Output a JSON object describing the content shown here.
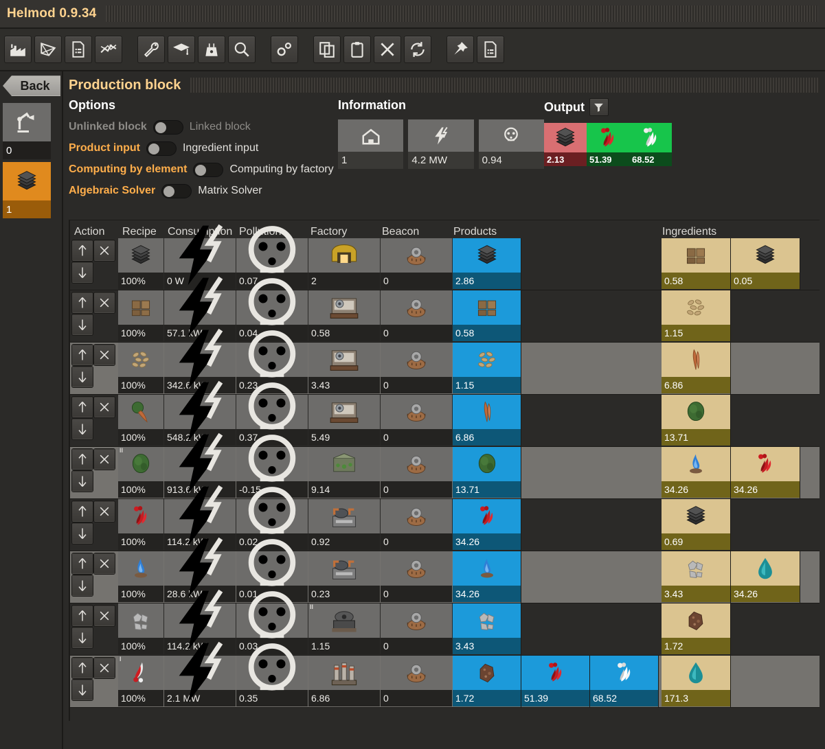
{
  "window": {
    "title": "Helmod 0.9.34"
  },
  "toolbar": {
    "buttons": [
      {
        "name": "factory-icon",
        "label": "Factory"
      },
      {
        "name": "polygon-graph-icon",
        "label": "Graph"
      },
      {
        "name": "document-icon",
        "label": "Summary"
      },
      {
        "name": "statistics-icon",
        "label": "Statistics"
      },
      {
        "name": "wrench-icon",
        "label": "Properties"
      },
      {
        "name": "graduation-cap-icon",
        "label": "Technology"
      },
      {
        "name": "power-plant-icon",
        "label": "Energy"
      },
      {
        "name": "magnifier-icon",
        "label": "Search"
      },
      {
        "name": "gears-icon",
        "label": "Preferences"
      },
      {
        "name": "copy-icon",
        "label": "Copy"
      },
      {
        "name": "clipboard-icon",
        "label": "Paste"
      },
      {
        "name": "close-x-icon",
        "label": "Erase"
      },
      {
        "name": "refresh-icon",
        "label": "Refresh"
      },
      {
        "name": "pin-icon",
        "label": "Pin"
      },
      {
        "name": "document-list-icon",
        "label": "Notes"
      }
    ]
  },
  "sidebar": {
    "back_label": "Back",
    "blocks": [
      {
        "name": "block-root",
        "icon": "robot-arm-icon",
        "label": "0",
        "selected": false
      },
      {
        "name": "block-production",
        "icon": "steel-plate-icon",
        "label": "1",
        "selected": true
      }
    ]
  },
  "panel": {
    "title": "Production block"
  },
  "options": {
    "title": "Options",
    "rows": [
      {
        "left": "Unlinked block",
        "right": "Linked block",
        "left_active": false,
        "state": "off"
      },
      {
        "left": "Product input",
        "right": "Ingredient input",
        "left_active": true,
        "state": "off"
      },
      {
        "left": "Computing by element",
        "right": "Computing by factory",
        "left_active": true,
        "state": "off"
      },
      {
        "left": "Algebraic Solver",
        "right": "Matrix Solver",
        "left_active": true,
        "state": "off"
      }
    ]
  },
  "information": {
    "title": "Information",
    "cells": [
      {
        "name": "building-count",
        "icon": "building-icon",
        "value": "1"
      },
      {
        "name": "power-usage",
        "icon": "energy-icon",
        "value": "4.2 MW"
      },
      {
        "name": "pollution",
        "icon": "pollution-icon",
        "value": "0.94"
      }
    ]
  },
  "output": {
    "title": "Output",
    "filter_icon": "filter-funnel-icon",
    "items": [
      {
        "name": "output-steel-plate",
        "icon": "steel-plate-icon",
        "value": "2.13",
        "color": "red"
      },
      {
        "name": "output-red-smoke",
        "icon": "heavy-oil-icon",
        "value": "51.39",
        "color": "green"
      },
      {
        "name": "output-white-smoke",
        "icon": "light-oil-icon",
        "value": "68.52",
        "color": "green"
      }
    ]
  },
  "table": {
    "headers": [
      "Action",
      "Recipe",
      "Consumption",
      "Pollution",
      "Factory",
      "Beacon",
      "Products",
      "Ingredients"
    ],
    "actions": {
      "up": "move-up",
      "down": "move-down",
      "remove": "remove"
    },
    "rows": [
      {
        "alt": false,
        "recipe": {
          "icon": "steel-plate-icon",
          "value": "100%"
        },
        "consumption": {
          "icon": "energy-icon",
          "value": "0 W"
        },
        "pollution": {
          "icon": "pollution-icon",
          "value": "0.07"
        },
        "factory": {
          "icon": "electric-furnace-icon",
          "value": "2"
        },
        "beacon": {
          "icon": "beacon-icon",
          "value": "0"
        },
        "products": [
          {
            "icon": "steel-plate-icon",
            "value": "2.86"
          }
        ],
        "ingredients": [
          {
            "icon": "wood-box-icon",
            "value": "0.58"
          },
          {
            "icon": "steel-plate-icon",
            "value": "0.05"
          }
        ]
      },
      {
        "alt": false,
        "recipe": {
          "icon": "wood-box-icon",
          "value": "100%"
        },
        "consumption": {
          "icon": "energy-icon",
          "value": "57.1 kW"
        },
        "pollution": {
          "icon": "pollution-icon",
          "value": "0.04"
        },
        "factory": {
          "icon": "assembling-machine-icon",
          "value": "0.58"
        },
        "beacon": {
          "icon": "beacon-icon",
          "value": "0"
        },
        "products": [
          {
            "icon": "wood-box-icon",
            "value": "0.58"
          }
        ],
        "ingredients": [
          {
            "icon": "wood-pellets-icon",
            "value": "1.15"
          }
        ]
      },
      {
        "alt": true,
        "recipe": {
          "icon": "wood-pellets-icon",
          "value": "100%"
        },
        "consumption": {
          "icon": "energy-icon",
          "value": "342.6 kW"
        },
        "pollution": {
          "icon": "pollution-icon",
          "value": "0.23"
        },
        "factory": {
          "icon": "assembling-machine-icon",
          "value": "3.43"
        },
        "beacon": {
          "icon": "beacon-icon",
          "value": "0"
        },
        "products": [
          {
            "icon": "wood-pellets-icon",
            "value": "1.15"
          }
        ],
        "ingredients": [
          {
            "icon": "wood-shavings-icon",
            "value": "6.86"
          }
        ]
      },
      {
        "alt": false,
        "recipe": {
          "icon": "tree-chop-icon",
          "value": "100%"
        },
        "consumption": {
          "icon": "energy-icon",
          "value": "548.2 kW"
        },
        "pollution": {
          "icon": "pollution-icon",
          "value": "0.37"
        },
        "factory": {
          "icon": "assembling-machine-icon",
          "value": "5.49"
        },
        "beacon": {
          "icon": "beacon-icon",
          "value": "0"
        },
        "products": [
          {
            "icon": "wood-shavings-icon",
            "value": "6.86"
          }
        ],
        "ingredients": [
          {
            "icon": "tree-icon",
            "value": "13.71"
          }
        ]
      },
      {
        "alt": true,
        "recipe": {
          "icon": "tree-icon",
          "value": "100%",
          "badge": "II"
        },
        "consumption": {
          "icon": "energy-icon",
          "value": "913.6 kW"
        },
        "pollution": {
          "icon": "pollution-icon",
          "value": "-0.15"
        },
        "factory": {
          "icon": "greenhouse-icon",
          "value": "9.14"
        },
        "beacon": {
          "icon": "beacon-icon",
          "value": "0"
        },
        "products": [
          {
            "icon": "tree-icon",
            "value": "13.71"
          }
        ],
        "ingredients": [
          {
            "icon": "blue-flame-icon",
            "value": "34.26"
          },
          {
            "icon": "heavy-oil-icon",
            "value": "34.26"
          }
        ]
      },
      {
        "alt": false,
        "recipe": {
          "icon": "heavy-oil-icon",
          "value": "100%"
        },
        "consumption": {
          "icon": "energy-icon",
          "value": "114.2 kW"
        },
        "pollution": {
          "icon": "pollution-icon",
          "value": "0.02"
        },
        "factory": {
          "icon": "chemical-plant-icon",
          "value": "0.92"
        },
        "beacon": {
          "icon": "beacon-icon",
          "value": "0"
        },
        "products": [
          {
            "icon": "heavy-oil-icon",
            "value": "34.26"
          }
        ],
        "ingredients": [
          {
            "icon": "steel-plate-icon",
            "value": "0.69"
          }
        ]
      },
      {
        "alt": true,
        "recipe": {
          "icon": "blue-flame-icon",
          "value": "100%"
        },
        "consumption": {
          "icon": "energy-icon",
          "value": "28.6 kW"
        },
        "pollution": {
          "icon": "pollution-icon",
          "value": "0.01"
        },
        "factory": {
          "icon": "chemical-plant-icon",
          "value": "0.23"
        },
        "beacon": {
          "icon": "beacon-icon",
          "value": "0"
        },
        "products": [
          {
            "icon": "blue-flame-icon",
            "value": "34.26"
          }
        ],
        "ingredients": [
          {
            "icon": "stone-icon",
            "value": "3.43"
          },
          {
            "icon": "water-drop-icon",
            "value": "34.26"
          }
        ]
      },
      {
        "alt": false,
        "recipe": {
          "icon": "stone-icon",
          "value": "100%"
        },
        "consumption": {
          "icon": "energy-icon",
          "value": "114.2 kW"
        },
        "pollution": {
          "icon": "pollution-icon",
          "value": "0.03"
        },
        "factory": {
          "icon": "stone-furnace-icon",
          "value": "1.15",
          "badge": "II"
        },
        "beacon": {
          "icon": "beacon-icon",
          "value": "0"
        },
        "products": [
          {
            "icon": "stone-icon",
            "value": "3.43"
          }
        ],
        "ingredients": [
          {
            "icon": "ore-rock-icon",
            "value": "1.72"
          }
        ]
      },
      {
        "alt": true,
        "recipe": {
          "icon": "red-white-flame-icon",
          "value": "100%",
          "badge": "I"
        },
        "consumption": {
          "icon": "energy-icon",
          "value": "2.1 MW"
        },
        "pollution": {
          "icon": "pollution-icon",
          "value": "0.35"
        },
        "factory": {
          "icon": "refinery-icon",
          "value": "6.86"
        },
        "beacon": {
          "icon": "beacon-icon",
          "value": "0"
        },
        "products": [
          {
            "icon": "ore-rock-icon",
            "value": "1.72"
          },
          {
            "icon": "heavy-oil-icon",
            "value": "51.39"
          },
          {
            "icon": "light-oil-icon",
            "value": "68.52"
          }
        ],
        "ingredients": [
          {
            "icon": "water-drop-icon",
            "value": "171.3"
          }
        ]
      }
    ]
  },
  "colors": {
    "accent_orange": "#ffd38f",
    "option_label": "#ffae4b",
    "product_blue": "#1c9ada",
    "ingredient_tan": "#dbc490",
    "output_red": "#d96f72",
    "output_green": "#17c54b",
    "selected_block": "#e08a1e"
  }
}
